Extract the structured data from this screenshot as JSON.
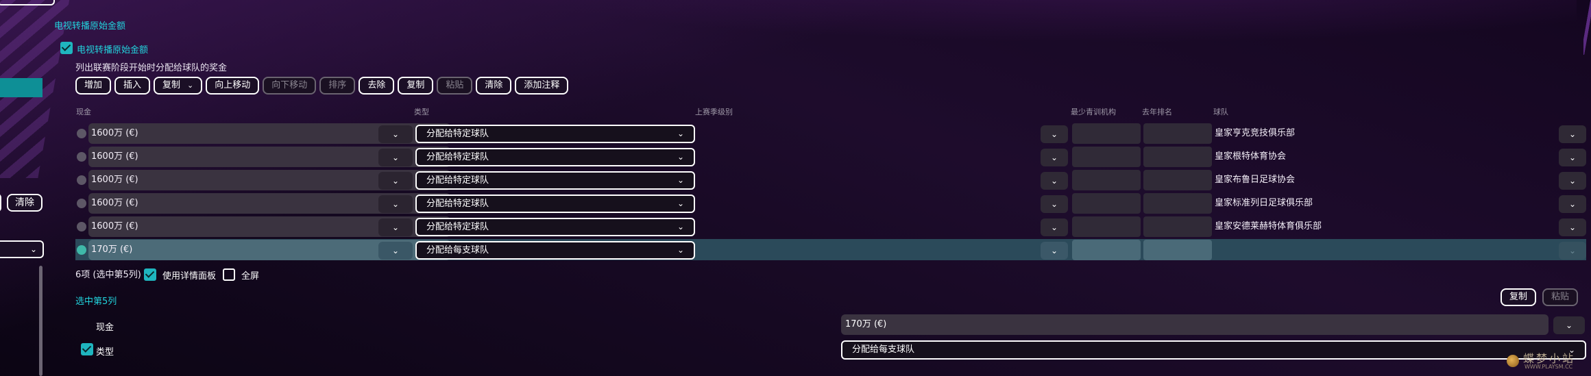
{
  "section_title": "电视转播原始金额",
  "main_checkbox_label": "电视转播原始金额",
  "description": "列出联赛阶段开始时分配给球队的奖金",
  "toolbar": [
    {
      "label": "增加",
      "enabled": true
    },
    {
      "label": "插入",
      "enabled": true
    },
    {
      "label": "复制",
      "enabled": true,
      "dropdown": true
    },
    {
      "label": "向上移动",
      "enabled": true
    },
    {
      "label": "向下移动",
      "enabled": false
    },
    {
      "label": "排序",
      "enabled": false
    },
    {
      "label": "去除",
      "enabled": true
    },
    {
      "label": "复制",
      "enabled": true
    },
    {
      "label": "粘贴",
      "enabled": false
    },
    {
      "label": "清除",
      "enabled": true
    },
    {
      "label": "添加注释",
      "enabled": true
    }
  ],
  "columns": {
    "cash": "现金",
    "type": "类型",
    "prev_division": "上赛季级别",
    "min_facility": "最少青训机构",
    "last_rank": "去年排名",
    "team": "球队"
  },
  "rows": [
    {
      "cash": "1600万 (€)",
      "type": "分配给特定球队",
      "team": "皇家亨克竞技俱乐部",
      "selected": false
    },
    {
      "cash": "1600万 (€)",
      "type": "分配给特定球队",
      "team": "皇家根特体育协会",
      "selected": false
    },
    {
      "cash": "1600万 (€)",
      "type": "分配给特定球队",
      "team": "皇家布鲁日足球协会",
      "selected": false
    },
    {
      "cash": "1600万 (€)",
      "type": "分配给特定球队",
      "team": "皇家标准列日足球俱乐部",
      "selected": false
    },
    {
      "cash": "1600万 (€)",
      "type": "分配给特定球队",
      "team": "皇家安德莱赫特体育俱乐部",
      "selected": false
    },
    {
      "cash": "170万 (€)",
      "type": "分配给每支球队",
      "team": "",
      "selected": true
    }
  ],
  "summary": "6项 (选中第5列)",
  "options": {
    "detail_panel_label": "使用详情面板",
    "detail_panel_checked": true,
    "fullscreen_label": "全屏",
    "fullscreen_checked": false
  },
  "left_panel": {
    "clear_label": "清除"
  },
  "detail": {
    "title": "选中第5列",
    "copy_label": "复制",
    "paste_label": "粘贴",
    "cash_label": "现金",
    "cash_value": "170万 (€)",
    "type_label": "类型",
    "type_value": "分配给每支球队"
  },
  "watermark": {
    "text": "蝶梦小站",
    "sub": "WWW.PLAYSM.CC"
  },
  "colors": {
    "accent": "#22d3dd",
    "selected_row": "#2b4a5a",
    "checkbox": "#1fb5bf",
    "background": "#15091f"
  },
  "icons": {
    "dropdown": "chevron-down-icon",
    "checkbox": "check-icon",
    "row_marker": "radio-dot-icon",
    "watermark": "watermark-logo-icon"
  }
}
